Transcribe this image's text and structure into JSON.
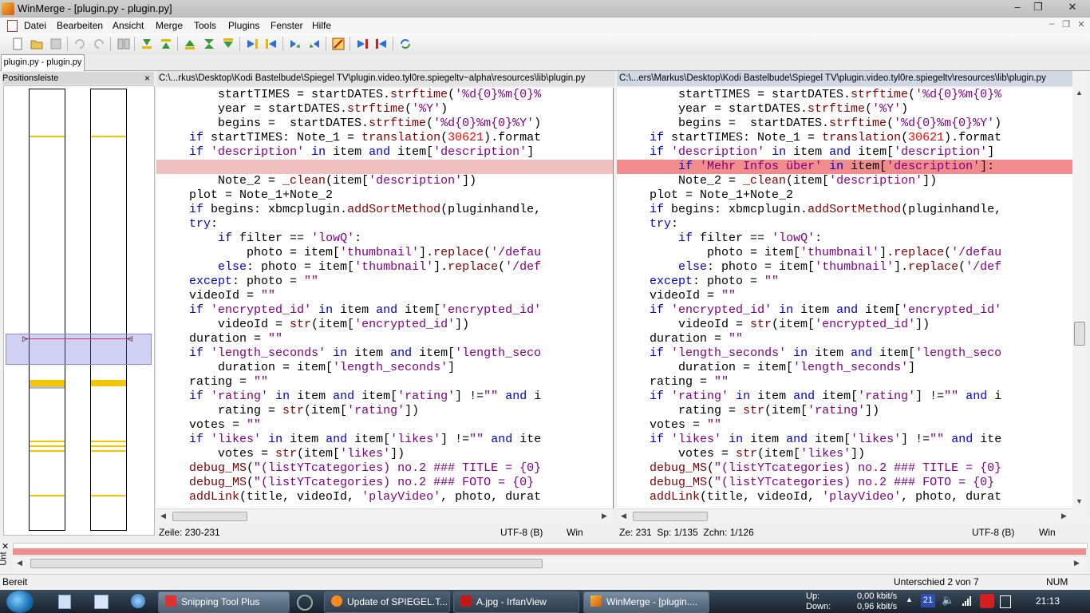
{
  "window": {
    "title": "WinMerge - [plugin.py - plugin.py]",
    "buttons": {
      "minimize": "‒",
      "maximize": "❐",
      "close": "✕"
    }
  },
  "menu": [
    "Datei",
    "Bearbeiten",
    "Ansicht",
    "Merge",
    "Tools",
    "Plugins",
    "Fenster",
    "Hilfe"
  ],
  "mdi_buttons": {
    "minimize": "‒",
    "restore": "❐",
    "close": "✕"
  },
  "tab": {
    "label": "plugin.py - plugin.py"
  },
  "location_pane": {
    "title": "Positionsleiste",
    "close": "×"
  },
  "left_pane": {
    "path": "C:\\...rkus\\Desktop\\Kodi Bastelbude\\Spiegel TV\\plugin.video.tyl0re.spiegeltv~alpha\\resources\\lib\\plugin.py",
    "lines": [
      "        startTIMES = startDATES.strftime('%d{0}%m{0}%",
      "        year = startDATES.strftime('%Y')",
      "        begins =  startDATES.strftime('%d{0}%m{0}%Y')",
      "    if startTIMES: Note_1 = translation(30621).format",
      "    if 'description' in item and item['description']",
      "",
      "        Note_2 = _clean(item['description'])",
      "    plot = Note_1+Note_2",
      "    if begins: xbmcplugin.addSortMethod(pluginhandle,",
      "    try:",
      "        if filter == 'lowQ':",
      "            photo = item['thumbnail'].replace('/defau",
      "        else: photo = item['thumbnail'].replace('/def",
      "    except: photo = \"\"",
      "    videoId = \"\"",
      "    if 'encrypted_id' in item and item['encrypted_id'",
      "        videoId = str(item['encrypted_id'])",
      "    duration = \"\"",
      "    if 'length_seconds' in item and item['length_seco",
      "        duration = item['length_seconds']",
      "    rating = \"\"",
      "    if 'rating' in item and item['rating'] !=\"\" and i",
      "        rating = str(item['rating'])",
      "    votes = \"\"",
      "    if 'likes' in item and item['likes'] !=\"\" and ite",
      "        votes = str(item['likes'])",
      "    debug_MS(\"(listYTcategories) no.2 ### TITLE = {0}",
      "    debug_MS(\"(listYTcategories) no.2 ### FOTO = {0}",
      "    addLink(title, videoId, 'playVideo', photo, durat"
    ]
  },
  "right_pane": {
    "path": "C:\\...ers\\Markus\\Desktop\\Kodi Bastelbude\\Spiegel TV\\plugin.video.tyl0re.spiegeltv\\resources\\lib\\plugin.py",
    "lines": [
      "        startTIMES = startDATES.strftime('%d{0}%m{0}%",
      "        year = startDATES.strftime('%Y')",
      "        begins =  startDATES.strftime('%d{0}%m{0}%Y')",
      "    if startTIMES: Note_1 = translation(30621).format",
      "    if 'description' in item and item['description']",
      "        if 'Mehr Infos über' in item['description']:",
      "        Note_2 = _clean(item['description'])",
      "    plot = Note_1+Note_2",
      "    if begins: xbmcplugin.addSortMethod(pluginhandle,",
      "    try:",
      "        if filter == 'lowQ':",
      "            photo = item['thumbnail'].replace('/defau",
      "        else: photo = item['thumbnail'].replace('/def",
      "    except: photo = \"\"",
      "    videoId = \"\"",
      "    if 'encrypted_id' in item and item['encrypted_id'",
      "        videoId = str(item['encrypted_id'])",
      "    duration = \"\"",
      "    if 'length_seconds' in item and item['length_seco",
      "        duration = item['length_seconds']",
      "    rating = \"\"",
      "    if 'rating' in item and item['rating'] !=\"\" and i",
      "        rating = str(item['rating'])",
      "    votes = \"\"",
      "    if 'likes' in item and item['likes'] !=\"\" and ite",
      "        votes = str(item['likes'])",
      "    debug_MS(\"(listYTcategories) no.2 ### TITLE = {0}",
      "    debug_MS(\"(listYTcategories) no.2 ### FOTO = {0}",
      "    addLink(title, videoId, 'playVideo', photo, durat"
    ]
  },
  "left_status": {
    "position": "Zeile: 230-231",
    "encoding": "UTF-8 (B)",
    "eol": "Win"
  },
  "right_status": {
    "position": "Ze: 231  Sp: 1/135  Zchn: 1/126",
    "encoding": "UTF-8 (B)",
    "eol": "Win"
  },
  "diff_pane": {
    "label": "Unt"
  },
  "statusbar": {
    "ready": "Bereit",
    "difference": "Unterschied 2 von 7",
    "numlock": "NUM"
  },
  "taskbar": {
    "items": [
      "Snipping Tool Plus",
      "Update of SPIEGEL.T...",
      "A.jpg - IrfanView",
      "WinMerge - [plugin...."
    ],
    "net": {
      "up_label": "Up:",
      "down_label": "Down:",
      "up_value": "0,00 kbit/s",
      "down_value": "0,96 kbit/s"
    },
    "tray_badge": "21",
    "clock": "21:13"
  },
  "colors": {
    "diff_current": "#f08c8c",
    "diff_empty": "#f0c0c0",
    "location_marker": "#f2c600"
  }
}
